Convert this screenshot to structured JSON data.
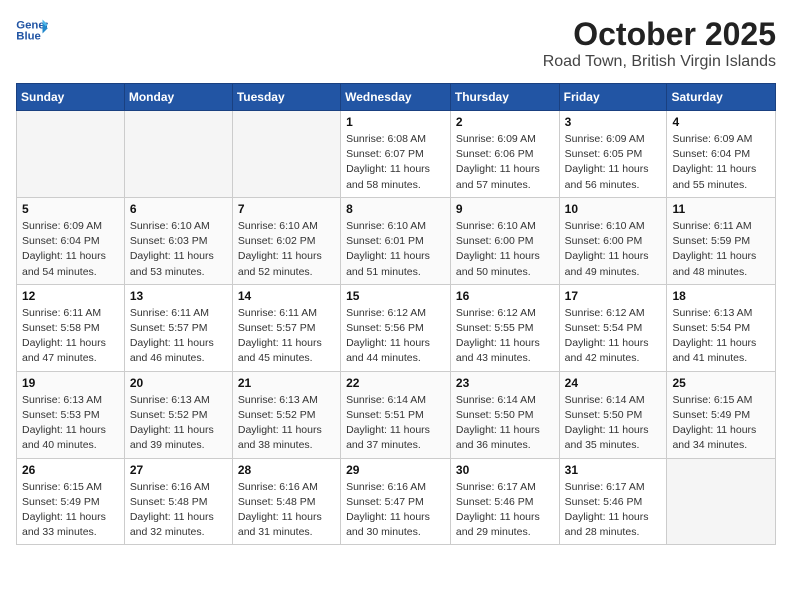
{
  "header": {
    "logo_line1": "General",
    "logo_line2": "Blue",
    "month": "October 2025",
    "location": "Road Town, British Virgin Islands"
  },
  "weekdays": [
    "Sunday",
    "Monday",
    "Tuesday",
    "Wednesday",
    "Thursday",
    "Friday",
    "Saturday"
  ],
  "weeks": [
    [
      {
        "day": "",
        "empty": true
      },
      {
        "day": "",
        "empty": true
      },
      {
        "day": "",
        "empty": true
      },
      {
        "day": "1",
        "sunrise": "6:08 AM",
        "sunset": "6:07 PM",
        "daylight": "11 hours and 58 minutes."
      },
      {
        "day": "2",
        "sunrise": "6:09 AM",
        "sunset": "6:06 PM",
        "daylight": "11 hours and 57 minutes."
      },
      {
        "day": "3",
        "sunrise": "6:09 AM",
        "sunset": "6:05 PM",
        "daylight": "11 hours and 56 minutes."
      },
      {
        "day": "4",
        "sunrise": "6:09 AM",
        "sunset": "6:04 PM",
        "daylight": "11 hours and 55 minutes."
      }
    ],
    [
      {
        "day": "5",
        "sunrise": "6:09 AM",
        "sunset": "6:04 PM",
        "daylight": "11 hours and 54 minutes."
      },
      {
        "day": "6",
        "sunrise": "6:10 AM",
        "sunset": "6:03 PM",
        "daylight": "11 hours and 53 minutes."
      },
      {
        "day": "7",
        "sunrise": "6:10 AM",
        "sunset": "6:02 PM",
        "daylight": "11 hours and 52 minutes."
      },
      {
        "day": "8",
        "sunrise": "6:10 AM",
        "sunset": "6:01 PM",
        "daylight": "11 hours and 51 minutes."
      },
      {
        "day": "9",
        "sunrise": "6:10 AM",
        "sunset": "6:00 PM",
        "daylight": "11 hours and 50 minutes."
      },
      {
        "day": "10",
        "sunrise": "6:10 AM",
        "sunset": "6:00 PM",
        "daylight": "11 hours and 49 minutes."
      },
      {
        "day": "11",
        "sunrise": "6:11 AM",
        "sunset": "5:59 PM",
        "daylight": "11 hours and 48 minutes."
      }
    ],
    [
      {
        "day": "12",
        "sunrise": "6:11 AM",
        "sunset": "5:58 PM",
        "daylight": "11 hours and 47 minutes."
      },
      {
        "day": "13",
        "sunrise": "6:11 AM",
        "sunset": "5:57 PM",
        "daylight": "11 hours and 46 minutes."
      },
      {
        "day": "14",
        "sunrise": "6:11 AM",
        "sunset": "5:57 PM",
        "daylight": "11 hours and 45 minutes."
      },
      {
        "day": "15",
        "sunrise": "6:12 AM",
        "sunset": "5:56 PM",
        "daylight": "11 hours and 44 minutes."
      },
      {
        "day": "16",
        "sunrise": "6:12 AM",
        "sunset": "5:55 PM",
        "daylight": "11 hours and 43 minutes."
      },
      {
        "day": "17",
        "sunrise": "6:12 AM",
        "sunset": "5:54 PM",
        "daylight": "11 hours and 42 minutes."
      },
      {
        "day": "18",
        "sunrise": "6:13 AM",
        "sunset": "5:54 PM",
        "daylight": "11 hours and 41 minutes."
      }
    ],
    [
      {
        "day": "19",
        "sunrise": "6:13 AM",
        "sunset": "5:53 PM",
        "daylight": "11 hours and 40 minutes."
      },
      {
        "day": "20",
        "sunrise": "6:13 AM",
        "sunset": "5:52 PM",
        "daylight": "11 hours and 39 minutes."
      },
      {
        "day": "21",
        "sunrise": "6:13 AM",
        "sunset": "5:52 PM",
        "daylight": "11 hours and 38 minutes."
      },
      {
        "day": "22",
        "sunrise": "6:14 AM",
        "sunset": "5:51 PM",
        "daylight": "11 hours and 37 minutes."
      },
      {
        "day": "23",
        "sunrise": "6:14 AM",
        "sunset": "5:50 PM",
        "daylight": "11 hours and 36 minutes."
      },
      {
        "day": "24",
        "sunrise": "6:14 AM",
        "sunset": "5:50 PM",
        "daylight": "11 hours and 35 minutes."
      },
      {
        "day": "25",
        "sunrise": "6:15 AM",
        "sunset": "5:49 PM",
        "daylight": "11 hours and 34 minutes."
      }
    ],
    [
      {
        "day": "26",
        "sunrise": "6:15 AM",
        "sunset": "5:49 PM",
        "daylight": "11 hours and 33 minutes."
      },
      {
        "day": "27",
        "sunrise": "6:16 AM",
        "sunset": "5:48 PM",
        "daylight": "11 hours and 32 minutes."
      },
      {
        "day": "28",
        "sunrise": "6:16 AM",
        "sunset": "5:48 PM",
        "daylight": "11 hours and 31 minutes."
      },
      {
        "day": "29",
        "sunrise": "6:16 AM",
        "sunset": "5:47 PM",
        "daylight": "11 hours and 30 minutes."
      },
      {
        "day": "30",
        "sunrise": "6:17 AM",
        "sunset": "5:46 PM",
        "daylight": "11 hours and 29 minutes."
      },
      {
        "day": "31",
        "sunrise": "6:17 AM",
        "sunset": "5:46 PM",
        "daylight": "11 hours and 28 minutes."
      },
      {
        "day": "",
        "empty": true
      }
    ]
  ],
  "labels": {
    "sunrise": "Sunrise:",
    "sunset": "Sunset:",
    "daylight": "Daylight:"
  }
}
